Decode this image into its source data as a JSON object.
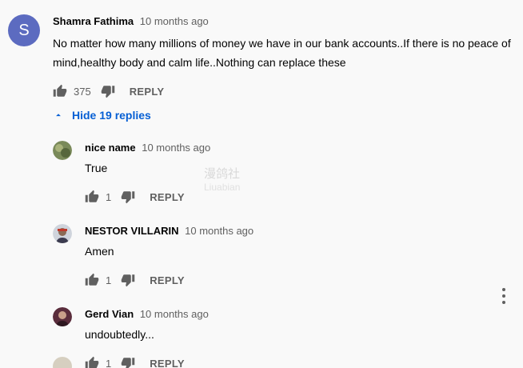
{
  "colors": {
    "background": "#f9f9f9",
    "avatar_main": "#5c6bc0",
    "link_blue": "#065fd4",
    "secondary_text": "#606060"
  },
  "main_comment": {
    "avatar_letter": "S",
    "author": "Shamra Fathima",
    "time": "10 months ago",
    "text": "No matter how many millions of money we have in our bank accounts..If there is no peace of mind,healthy body and calm life..Nothing can replace these",
    "likes": "375",
    "reply_label": "REPLY",
    "icons": {
      "like": "thumbs-up-icon",
      "dislike": "thumbs-down-icon"
    }
  },
  "toggle": {
    "label": "Hide 19 replies",
    "icon": "chevron-up-icon"
  },
  "replies": [
    {
      "author": "nice name",
      "time": "10 months ago",
      "text": "True",
      "likes": "1",
      "reply_label": "REPLY"
    },
    {
      "author": "NESTOR VILLARIN",
      "time": "10 months ago",
      "text": "Amen",
      "likes": "1",
      "reply_label": "REPLY"
    },
    {
      "author": "Gerd Vian",
      "time": "10 months ago",
      "text": "undoubtedly...",
      "likes": "1",
      "reply_label": "REPLY"
    }
  ],
  "menu_icon": "more-vertical-icon",
  "watermark": {
    "line1": "漫鸽社",
    "line2": "Liuabian"
  }
}
